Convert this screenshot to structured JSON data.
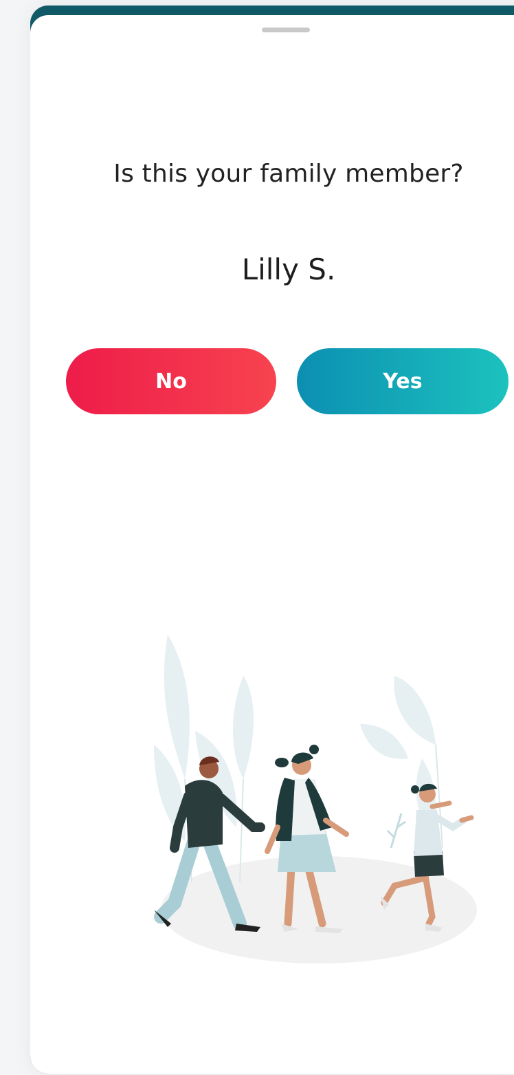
{
  "dialog": {
    "question": "Is this your family member?",
    "member_name": "Lilly S."
  },
  "actions": {
    "no_label": "No",
    "yes_label": "Yes"
  },
  "colors": {
    "header_bar": "#0f5a66",
    "no_button_start": "#ee1c4a",
    "no_button_end": "#f7434f",
    "yes_button_start": "#0c8fb2",
    "yes_button_end": "#1cc2be"
  },
  "illustration": {
    "icon": "family-walking-illustration"
  }
}
